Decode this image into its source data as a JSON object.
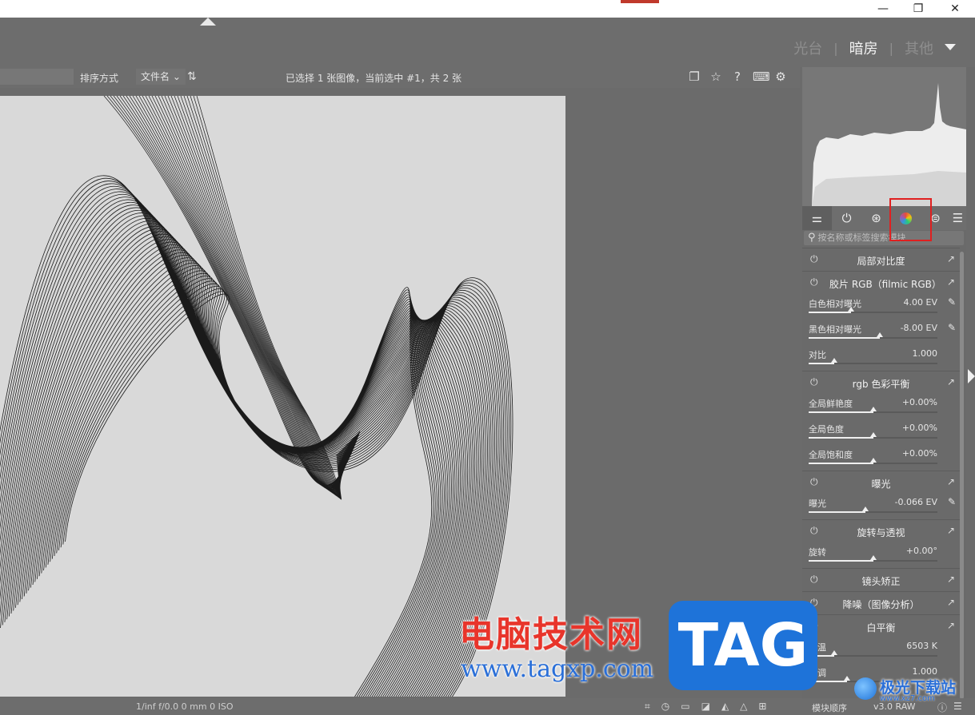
{
  "window": {
    "minimize": "—",
    "restore": "❐",
    "close": "✕"
  },
  "views": {
    "lighttable": "光台",
    "darkroom": "暗房",
    "other": "其他",
    "separator": "|"
  },
  "filmstrip_bar": {
    "sort_label": "排序方式",
    "sort_value": "文件名",
    "sort_dropdown_icon": "chevron-down-icon",
    "sort_order_icon": "sort-order-icon",
    "selection_info": "已选择 1 张图像，当前选中 #1，共 2 张",
    "icons": [
      "window-icon",
      "star-icon",
      "help-icon",
      "keyboard-icon",
      "gear-icon"
    ]
  },
  "panel": {
    "tabs": [
      {
        "name": "sliders-icon",
        "glyph": "⚌",
        "active": true
      },
      {
        "name": "power-icon",
        "glyph": "⏻",
        "active": false
      },
      {
        "name": "aperture-icon",
        "glyph": "⊛",
        "active": false
      },
      {
        "name": "color-icon",
        "glyph": "",
        "active": false
      },
      {
        "name": "correct-icon",
        "glyph": "⊜",
        "active": false
      },
      {
        "name": "presets-menu-icon",
        "glyph": "☰",
        "active": false
      }
    ],
    "search_placeholder": "按名称或标签搜索模块",
    "modules": [
      {
        "title": "局部对比度",
        "params": []
      },
      {
        "title": "胶片 RGB（filmic RGB）",
        "params": [
          {
            "label": "白色相对曝光",
            "value": "4.00 EV",
            "picker": true,
            "level": 0.33
          },
          {
            "label": "黑色相对曝光",
            "value": "-8.00 EV",
            "picker": true,
            "level": 0.55
          },
          {
            "label": "对比",
            "value": "1.000",
            "picker": false,
            "level": 0.2
          }
        ]
      },
      {
        "title": "rgb 色彩平衡",
        "params": [
          {
            "label": "全局鲜艳度",
            "value": "+0.00%",
            "picker": false,
            "level": 0.5
          },
          {
            "label": "全局色度",
            "value": "+0.00%",
            "picker": false,
            "level": 0.5
          },
          {
            "label": "全局饱和度",
            "value": "+0.00%",
            "picker": false,
            "level": 0.5
          }
        ]
      },
      {
        "title": "曝光",
        "params": [
          {
            "label": "曝光",
            "value": "-0.066 EV",
            "picker": true,
            "level": 0.44
          }
        ]
      },
      {
        "title": "旋转与透视",
        "params": [
          {
            "label": "旋转",
            "value": "+0.00°",
            "picker": false,
            "level": 0.5
          }
        ]
      },
      {
        "title": "镜头矫正",
        "params": []
      },
      {
        "title": "降噪（图像分析）",
        "params": []
      },
      {
        "title": "白平衡",
        "params": [
          {
            "label": "色温",
            "value": "6503 K",
            "picker": false,
            "level": 0.2
          },
          {
            "label": "色调",
            "value": "1.000",
            "picker": false,
            "level": 0.3
          }
        ]
      }
    ]
  },
  "bottom_bar": {
    "exif": "1/inf f/0.0 0 mm 0 ISO",
    "icons": [
      "focus-icon",
      "clock-icon",
      "display-icon",
      "softproof-icon",
      "gamut-icon",
      "warning-icon",
      "grid-icon"
    ],
    "module_order_label": "模块顺序",
    "module_order_value": "v3.0 RAW",
    "end_icons": [
      "help-icon",
      "menu-icon"
    ]
  },
  "watermark": {
    "cn_text": "电脑技术网",
    "url": "www.tagxp.com",
    "tag": "TAG",
    "jiguang": "极光下载站",
    "jiguang_url": "www.xz7.com"
  }
}
